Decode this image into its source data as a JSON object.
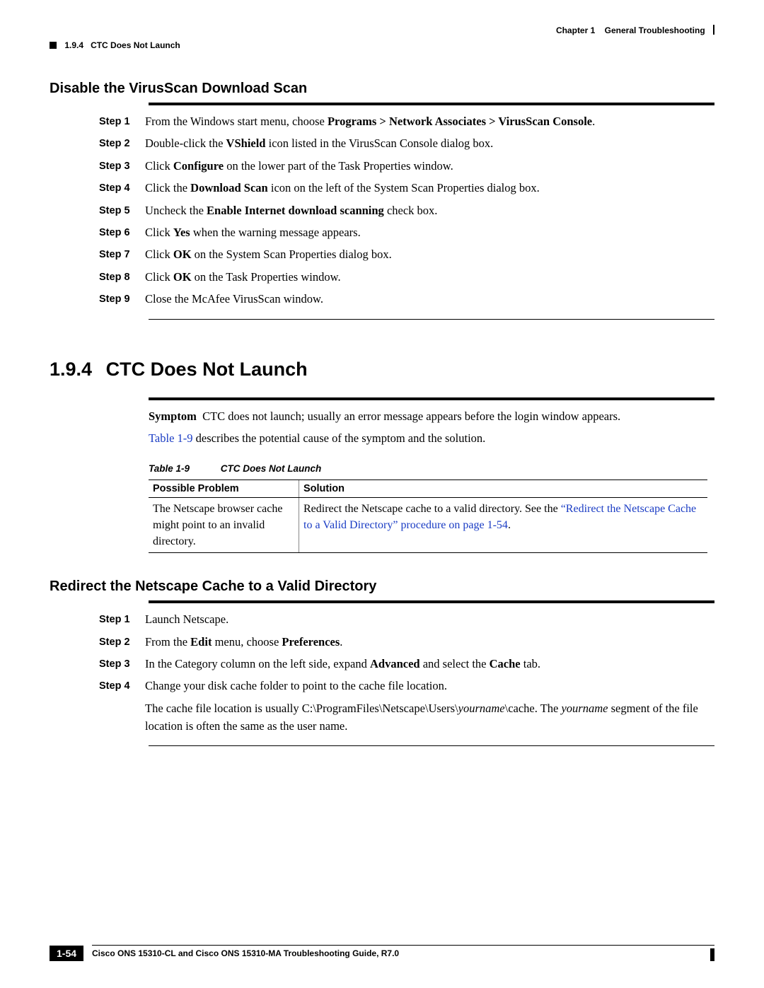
{
  "header": {
    "chapter": "Chapter 1",
    "chapter_title": "General Troubleshooting",
    "crumb_num": "1.9.4",
    "crumb_title": "CTC Does Not Launch"
  },
  "section1": {
    "title": "Disable the VirusScan Download Scan",
    "steps": [
      {
        "label": "Step 1",
        "html": "From the Windows start menu, choose <b>Programs > Network Associates > VirusScan Console</b>."
      },
      {
        "label": "Step 2",
        "html": "Double-click the <b>VShield</b> icon listed in the VirusScan Console dialog box."
      },
      {
        "label": "Step 3",
        "html": "Click <b>Configure</b> on the lower part of the Task Properties window."
      },
      {
        "label": "Step 4",
        "html": "Click the <b>Download Scan</b> icon on the left of the System Scan Properties dialog box."
      },
      {
        "label": "Step 5",
        "html": "Uncheck the <b>Enable Internet download scanning</b> check box."
      },
      {
        "label": "Step 6",
        "html": "Click <b>Yes</b> when the warning message appears."
      },
      {
        "label": "Step 7",
        "html": "Click <b>OK</b> on the System Scan Properties dialog box."
      },
      {
        "label": "Step 8",
        "html": "Click <b>OK</b> on the Task Properties window."
      },
      {
        "label": "Step 9",
        "html": "Close the McAfee VirusScan window."
      }
    ]
  },
  "section2": {
    "number": "1.9.4",
    "title": "CTC Does Not Launch",
    "symptom_html": "<b>Symptom</b>&nbsp;&nbsp;CTC does not launch; usually an error message appears before the login window appears.",
    "ref_html": "<span class=\"link\">Table 1-9</span> describes the potential cause of the symptom and the solution.",
    "table": {
      "caption_num": "Table 1-9",
      "caption_title": "CTC Does Not Launch",
      "col1": "Possible Problem",
      "col2": "Solution",
      "row1_problem": "The Netscape browser cache might point to an invalid directory.",
      "row1_solution_html": "Redirect the Netscape cache to a valid directory. See the <span class=\"link\">“Redirect the Netscape Cache to a Valid Directory” procedure on page 1-54</span>."
    }
  },
  "section3": {
    "title": "Redirect the Netscape Cache to a Valid Directory",
    "steps": [
      {
        "label": "Step 1",
        "html": "Launch Netscape."
      },
      {
        "label": "Step 2",
        "html": "From the <b>Edit</b> menu, choose <b>Preferences</b>."
      },
      {
        "label": "Step 3",
        "html": "In the Category column on the left side, expand <b>Advanced</b> and select the <b>Cache</b> tab."
      },
      {
        "label": "Step 4",
        "html": "Change your disk cache folder to point to the cache file location."
      }
    ],
    "note_html": "The cache file location is usually C:\\ProgramFiles\\Netscape\\Users\\<i>yourname</i>\\cache. The <i>yourname</i> segment of the file location is often the same as the user name."
  },
  "footer": {
    "title": "Cisco ONS 15310-CL and Cisco ONS 15310-MA Troubleshooting Guide, R7.0",
    "page": "1-54"
  }
}
